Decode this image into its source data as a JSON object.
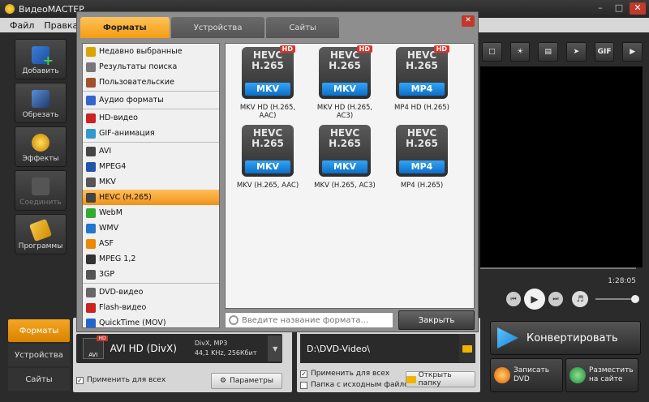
{
  "window": {
    "title": "ВидеоМАСТЕР"
  },
  "menu": [
    "Файл",
    "Правка",
    "("
  ],
  "toolbar": [
    {
      "label": "Добавить",
      "icon": "add-video-icon",
      "enabled": true
    },
    {
      "label": "Обрезать",
      "icon": "scissors-icon",
      "enabled": true
    },
    {
      "label": "Эффекты",
      "icon": "magic-wand-icon",
      "enabled": true
    },
    {
      "label": "Соединить",
      "icon": "join-icon",
      "enabled": false
    },
    {
      "label": "Программы",
      "icon": "tickets-icon",
      "enabled": true
    }
  ],
  "side_tabs": [
    {
      "label": "Форматы",
      "active": true
    },
    {
      "label": "Устройства",
      "active": false
    },
    {
      "label": "Сайты",
      "active": false
    }
  ],
  "dialog": {
    "tabs": [
      {
        "label": "Форматы",
        "active": true
      },
      {
        "label": "Устройства",
        "active": false
      },
      {
        "label": "Сайты",
        "active": false
      }
    ],
    "categories": [
      {
        "label": "Недавно выбранные",
        "icon": "star-icon",
        "color": "#d9a400"
      },
      {
        "label": "Результаты поиска",
        "icon": "search-icon",
        "color": "#777777"
      },
      {
        "label": "Пользовательские",
        "icon": "user-icon",
        "color": "#a0522d",
        "sep_after": true
      },
      {
        "label": "Аудио форматы",
        "icon": "music-note-icon",
        "color": "#3366cc",
        "sep_after": true
      },
      {
        "label": "HD-видео",
        "icon": "hd-icon",
        "color": "#cc2222"
      },
      {
        "label": "GIF-анимация",
        "icon": "gif-icon",
        "color": "#3399cc",
        "sep_after": true
      },
      {
        "label": "AVI",
        "icon": "avi-icon",
        "color": "#444444"
      },
      {
        "label": "MPEG4",
        "icon": "mpeg4-icon",
        "color": "#2255aa"
      },
      {
        "label": "MKV",
        "icon": "mkv-icon",
        "color": "#555555"
      },
      {
        "label": "HEVC (H.265)",
        "icon": "hevc-icon",
        "color": "#444444",
        "selected": true
      },
      {
        "label": "WebM",
        "icon": "webm-icon",
        "color": "#33aa33"
      },
      {
        "label": "WMV",
        "icon": "wmv-icon",
        "color": "#2277cc"
      },
      {
        "label": "ASF",
        "icon": "asf-icon",
        "color": "#ee8800"
      },
      {
        "label": "MPEG 1,2",
        "icon": "mpeg-icon",
        "color": "#333333"
      },
      {
        "label": "3GP",
        "icon": "3gp-icon",
        "color": "#555555",
        "sep_after": true
      },
      {
        "label": "DVD-видео",
        "icon": "dvd-icon",
        "color": "#666666"
      },
      {
        "label": "Flash-видео",
        "icon": "flash-icon",
        "color": "#cc2222"
      },
      {
        "label": "QuickTime (MOV)",
        "icon": "quicktime-icon",
        "color": "#2266cc"
      }
    ],
    "formats": [
      {
        "top": "HEVC\nH.265",
        "label": "MKV",
        "hd": "HD",
        "caption": "MKV HD (H.265, AAC)"
      },
      {
        "top": "HEVC\nH.265",
        "label": "MKV",
        "hd": "HD",
        "caption": "MKV HD (H.265, AC3)"
      },
      {
        "top": "HEVC\nH.265",
        "label": "MP4",
        "hd": "HD",
        "caption": "MP4 HD (H.265)"
      },
      {
        "top": "HEVC\nH.265",
        "label": "MKV",
        "hd": "",
        "caption": "MKV (H.265, AAC)"
      },
      {
        "top": "HEVC\nH.265",
        "label": "MKV",
        "hd": "",
        "caption": "MKV (H.265, AC3)"
      },
      {
        "top": "HEVC\nH.265",
        "label": "MP4",
        "hd": "",
        "caption": "MP4 (H.265)"
      }
    ],
    "search_placeholder": "Введите название формата...",
    "close_label": "Закрыть"
  },
  "output_format": {
    "name": "AVI HD (DivX)",
    "icon_label": "AVI",
    "icon_badge": "HD",
    "specs_line1": "DivX, MP3",
    "specs_line2": "44,1 KHz, 256Кбит",
    "apply_all_label": "Применить для всех",
    "apply_all_checked": true,
    "params_label": "Параметры"
  },
  "output_folder": {
    "path": "D:\\DVD-Video\\",
    "apply_all_label": "Применить для всех",
    "apply_all_checked": true,
    "source_folder_label": "Папка с исходным файлом",
    "source_folder_checked": false,
    "open_folder_label": "Открыть папку"
  },
  "preview": {
    "time": "1:28:05",
    "tools": [
      {
        "icon": "crop-icon",
        "text": ""
      },
      {
        "icon": "brightness-icon",
        "text": ""
      },
      {
        "icon": "film-icon",
        "text": ""
      },
      {
        "icon": "runner-icon",
        "text": ""
      },
      {
        "icon": "gif-icon",
        "text": "GIF"
      },
      {
        "icon": "screenshot-icon",
        "text": ""
      }
    ]
  },
  "actions": {
    "convert_label": "Конвертировать",
    "burn_label": "Записать DVD",
    "share_label": "Разместить на сайте"
  }
}
